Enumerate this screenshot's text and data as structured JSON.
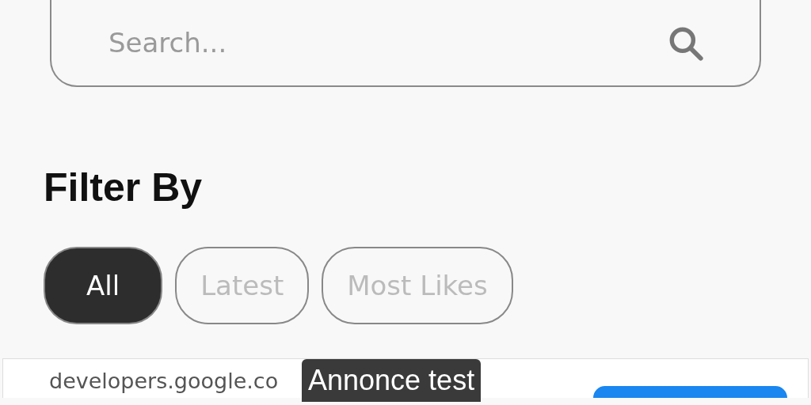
{
  "search": {
    "placeholder": "Search..."
  },
  "filter_heading": "Filter By",
  "filters": [
    {
      "label": "All",
      "selected": true
    },
    {
      "label": "Latest",
      "selected": false
    },
    {
      "label": "Most Likes",
      "selected": false
    }
  ],
  "ad": {
    "badge": "Annonce test",
    "url": "developers.google.co"
  }
}
